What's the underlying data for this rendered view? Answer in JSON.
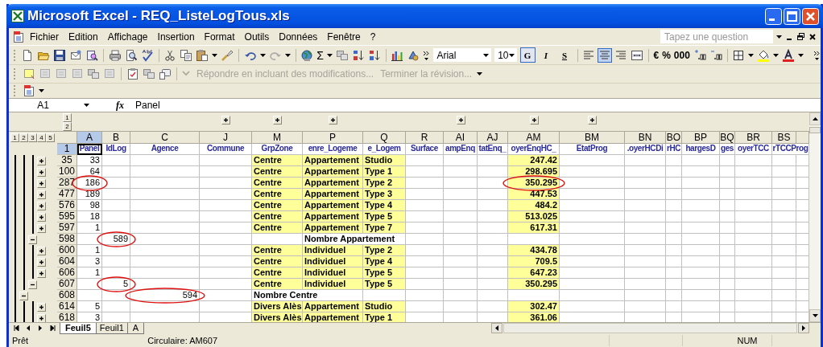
{
  "window": {
    "title": "Microsoft Excel - REQ_ListeLogTous.xls"
  },
  "menu": {
    "items": [
      "Fichier",
      "Edition",
      "Affichage",
      "Insertion",
      "Format",
      "Outils",
      "Données",
      "Fenêtre",
      "?"
    ],
    "question_field": {
      "placeholder": "Tapez une question"
    }
  },
  "toolbar": {
    "sum_symbol": "Σ",
    "font": "Arial",
    "font_size": "10",
    "style_buttons": [
      {
        "label": "G",
        "pressed": true
      },
      {
        "label": "I",
        "pressed": false
      },
      {
        "label": "S",
        "pressed": false
      }
    ],
    "alignment": [
      {
        "kind": "left",
        "pressed": false
      },
      {
        "kind": "center",
        "pressed": true
      },
      {
        "kind": "right",
        "pressed": false
      }
    ],
    "number_formats": [
      "€",
      "%",
      "000"
    ]
  },
  "review_toolbar": {
    "items": [
      {
        "label": "Répondre en incluant des modifications...",
        "disabled": true
      },
      {
        "label": "Terminer la révision...",
        "disabled": true
      }
    ]
  },
  "formula_bar": {
    "cell": "A1",
    "fx": "fx",
    "formula": "Panel"
  },
  "sheet": {
    "row_outline_levels": [
      "1",
      "2",
      "3",
      "4",
      "5"
    ],
    "column_outline_levels": [
      "1",
      "2"
    ],
    "columns": [
      {
        "letter": "A",
        "header": "Panel",
        "selected": true,
        "group_button": false
      },
      {
        "letter": "B",
        "header": "IdLog",
        "selected": false,
        "group_button": false
      },
      {
        "letter": "C",
        "header": "Agence",
        "selected": false,
        "group_button": false
      },
      {
        "letter": "J",
        "header": "Commune",
        "selected": false,
        "group_button": true
      },
      {
        "letter": "M",
        "header": "GrpZone",
        "selected": false,
        "group_button": true
      },
      {
        "letter": "P",
        "header": "enre_Logeme",
        "selected": false,
        "group_button": true
      },
      {
        "letter": "Q",
        "header": "e_Logem",
        "selected": false,
        "group_button": false
      },
      {
        "letter": "R",
        "header": "Surface",
        "selected": false,
        "group_button": false
      },
      {
        "letter": "AI",
        "header": "ampEnq",
        "selected": false,
        "group_button": true
      },
      {
        "letter": "AJ",
        "header": "tatEnq_",
        "selected": false,
        "group_button": false
      },
      {
        "letter": "AM",
        "header": "oyerEnqHC_",
        "selected": false,
        "group_button": true
      },
      {
        "letter": "BM",
        "header": "EtatProg",
        "selected": false,
        "group_button": true
      },
      {
        "letter": "BN",
        "header": ".oyerHCDi",
        "selected": false,
        "group_button": false
      },
      {
        "letter": "BO",
        "header": "rHC",
        "selected": false,
        "group_button": false
      },
      {
        "letter": "BP",
        "header": "hargesD",
        "selected": false,
        "group_button": false
      },
      {
        "letter": "BQ",
        "header": "ges",
        "selected": false,
        "group_button": false
      },
      {
        "letter": "BR",
        "header": "oyerTCC",
        "selected": false,
        "group_button": false
      },
      {
        "letter": "BS",
        "header": "rTCCProg",
        "selected": false,
        "group_button": false
      }
    ],
    "header_row": {
      "number": "1",
      "selected": true
    },
    "rows": [
      {
        "number": "35",
        "kind": "detail",
        "cells": [
          {
            "text": "33",
            "highlighted": false,
            "circled": false
          },
          {
            "text": "",
            "highlighted": false,
            "circled": false
          },
          {
            "text": "",
            "highlighted": false,
            "circled": false
          },
          {
            "text": "",
            "highlighted": false,
            "circled": false
          },
          {
            "text": "Centre",
            "highlighted": true,
            "circled": false
          },
          {
            "text": "Appartement",
            "highlighted": true,
            "circled": false
          },
          {
            "text": "Studio",
            "highlighted": true,
            "circled": false
          },
          {
            "text": "",
            "highlighted": false,
            "circled": false
          },
          {
            "text": "",
            "highlighted": false,
            "circled": false
          },
          {
            "text": "",
            "highlighted": false,
            "circled": false
          },
          {
            "text": "247.42",
            "highlighted": true,
            "circled": false
          },
          {
            "text": "",
            "highlighted": false,
            "circled": false
          },
          {
            "text": "",
            "highlighted": false,
            "circled": false
          },
          {
            "text": "",
            "highlighted": false,
            "circled": false
          },
          {
            "text": "",
            "highlighted": false,
            "circled": false
          },
          {
            "text": "",
            "highlighted": false,
            "circled": false
          },
          {
            "text": "",
            "highlighted": false,
            "circled": false
          },
          {
            "text": "",
            "highlighted": false,
            "circled": false
          }
        ]
      },
      {
        "number": "100",
        "kind": "detail",
        "cells": [
          {
            "text": "64",
            "highlighted": false,
            "circled": false
          },
          {
            "text": "",
            "highlighted": false,
            "circled": false
          },
          {
            "text": "",
            "highlighted": false,
            "circled": false
          },
          {
            "text": "",
            "highlighted": false,
            "circled": false
          },
          {
            "text": "Centre",
            "highlighted": true,
            "circled": false
          },
          {
            "text": "Appartement",
            "highlighted": true,
            "circled": false
          },
          {
            "text": "Type 1",
            "highlighted": true,
            "circled": false
          },
          {
            "text": "",
            "highlighted": false,
            "circled": false
          },
          {
            "text": "",
            "highlighted": false,
            "circled": false
          },
          {
            "text": "",
            "highlighted": false,
            "circled": false
          },
          {
            "text": "298.695",
            "highlighted": true,
            "circled": false
          },
          {
            "text": "",
            "highlighted": false,
            "circled": false
          },
          {
            "text": "",
            "highlighted": false,
            "circled": false
          },
          {
            "text": "",
            "highlighted": false,
            "circled": false
          },
          {
            "text": "",
            "highlighted": false,
            "circled": false
          },
          {
            "text": "",
            "highlighted": false,
            "circled": false
          },
          {
            "text": "",
            "highlighted": false,
            "circled": false
          },
          {
            "text": "",
            "highlighted": false,
            "circled": false
          }
        ]
      },
      {
        "number": "287",
        "kind": "detail",
        "cells": [
          {
            "text": "186",
            "highlighted": false,
            "circled": true
          },
          {
            "text": "",
            "highlighted": false,
            "circled": false
          },
          {
            "text": "",
            "highlighted": false,
            "circled": false
          },
          {
            "text": "",
            "highlighted": false,
            "circled": false
          },
          {
            "text": "Centre",
            "highlighted": true,
            "circled": false
          },
          {
            "text": "Appartement",
            "highlighted": true,
            "circled": false
          },
          {
            "text": "Type 2",
            "highlighted": true,
            "circled": false
          },
          {
            "text": "",
            "highlighted": false,
            "circled": false
          },
          {
            "text": "",
            "highlighted": false,
            "circled": false
          },
          {
            "text": "",
            "highlighted": false,
            "circled": false
          },
          {
            "text": "350.295",
            "highlighted": true,
            "circled": true
          },
          {
            "text": "",
            "highlighted": false,
            "circled": false
          },
          {
            "text": "",
            "highlighted": false,
            "circled": false
          },
          {
            "text": "",
            "highlighted": false,
            "circled": false
          },
          {
            "text": "",
            "highlighted": false,
            "circled": false
          },
          {
            "text": "",
            "highlighted": false,
            "circled": false
          },
          {
            "text": "",
            "highlighted": false,
            "circled": false
          },
          {
            "text": "",
            "highlighted": false,
            "circled": false
          }
        ]
      },
      {
        "number": "477",
        "kind": "detail",
        "cells": [
          {
            "text": "189",
            "highlighted": false,
            "circled": false
          },
          {
            "text": "",
            "highlighted": false,
            "circled": false
          },
          {
            "text": "",
            "highlighted": false,
            "circled": false
          },
          {
            "text": "",
            "highlighted": false,
            "circled": false
          },
          {
            "text": "Centre",
            "highlighted": true,
            "circled": false
          },
          {
            "text": "Appartement",
            "highlighted": true,
            "circled": false
          },
          {
            "text": "Type 3",
            "highlighted": true,
            "circled": false
          },
          {
            "text": "",
            "highlighted": false,
            "circled": false
          },
          {
            "text": "",
            "highlighted": false,
            "circled": false
          },
          {
            "text": "",
            "highlighted": false,
            "circled": false
          },
          {
            "text": "447.53",
            "highlighted": true,
            "circled": false
          },
          {
            "text": "",
            "highlighted": false,
            "circled": false
          },
          {
            "text": "",
            "highlighted": false,
            "circled": false
          },
          {
            "text": "",
            "highlighted": false,
            "circled": false
          },
          {
            "text": "",
            "highlighted": false,
            "circled": false
          },
          {
            "text": "",
            "highlighted": false,
            "circled": false
          },
          {
            "text": "",
            "highlighted": false,
            "circled": false
          },
          {
            "text": "",
            "highlighted": false,
            "circled": false
          }
        ]
      },
      {
        "number": "576",
        "kind": "detail",
        "cells": [
          {
            "text": "98",
            "highlighted": false,
            "circled": false
          },
          {
            "text": "",
            "highlighted": false,
            "circled": false
          },
          {
            "text": "",
            "highlighted": false,
            "circled": false
          },
          {
            "text": "",
            "highlighted": false,
            "circled": false
          },
          {
            "text": "Centre",
            "highlighted": true,
            "circled": false
          },
          {
            "text": "Appartement",
            "highlighted": true,
            "circled": false
          },
          {
            "text": "Type 4",
            "highlighted": true,
            "circled": false
          },
          {
            "text": "",
            "highlighted": false,
            "circled": false
          },
          {
            "text": "",
            "highlighted": false,
            "circled": false
          },
          {
            "text": "",
            "highlighted": false,
            "circled": false
          },
          {
            "text": "484.2",
            "highlighted": true,
            "circled": false
          },
          {
            "text": "",
            "highlighted": false,
            "circled": false
          },
          {
            "text": "",
            "highlighted": false,
            "circled": false
          },
          {
            "text": "",
            "highlighted": false,
            "circled": false
          },
          {
            "text": "",
            "highlighted": false,
            "circled": false
          },
          {
            "text": "",
            "highlighted": false,
            "circled": false
          },
          {
            "text": "",
            "highlighted": false,
            "circled": false
          },
          {
            "text": "",
            "highlighted": false,
            "circled": false
          }
        ]
      },
      {
        "number": "595",
        "kind": "detail",
        "cells": [
          {
            "text": "18",
            "highlighted": false,
            "circled": false
          },
          {
            "text": "",
            "highlighted": false,
            "circled": false
          },
          {
            "text": "",
            "highlighted": false,
            "circled": false
          },
          {
            "text": "",
            "highlighted": false,
            "circled": false
          },
          {
            "text": "Centre",
            "highlighted": true,
            "circled": false
          },
          {
            "text": "Appartement",
            "highlighted": true,
            "circled": false
          },
          {
            "text": "Type 5",
            "highlighted": true,
            "circled": false
          },
          {
            "text": "",
            "highlighted": false,
            "circled": false
          },
          {
            "text": "",
            "highlighted": false,
            "circled": false
          },
          {
            "text": "",
            "highlighted": false,
            "circled": false
          },
          {
            "text": "513.025",
            "highlighted": true,
            "circled": false
          },
          {
            "text": "",
            "highlighted": false,
            "circled": false
          },
          {
            "text": "",
            "highlighted": false,
            "circled": false
          },
          {
            "text": "",
            "highlighted": false,
            "circled": false
          },
          {
            "text": "",
            "highlighted": false,
            "circled": false
          },
          {
            "text": "",
            "highlighted": false,
            "circled": false
          },
          {
            "text": "",
            "highlighted": false,
            "circled": false
          },
          {
            "text": "",
            "highlighted": false,
            "circled": false
          }
        ]
      },
      {
        "number": "597",
        "kind": "detail",
        "cells": [
          {
            "text": "1",
            "highlighted": false,
            "circled": false
          },
          {
            "text": "",
            "highlighted": false,
            "circled": false
          },
          {
            "text": "",
            "highlighted": false,
            "circled": false
          },
          {
            "text": "",
            "highlighted": false,
            "circled": false
          },
          {
            "text": "Centre",
            "highlighted": true,
            "circled": false
          },
          {
            "text": "Appartement",
            "highlighted": true,
            "circled": false
          },
          {
            "text": "Type 7",
            "highlighted": true,
            "circled": false
          },
          {
            "text": "",
            "highlighted": false,
            "circled": false
          },
          {
            "text": "",
            "highlighted": false,
            "circled": false
          },
          {
            "text": "",
            "highlighted": false,
            "circled": false
          },
          {
            "text": "617.31",
            "highlighted": true,
            "circled": false
          },
          {
            "text": "",
            "highlighted": false,
            "circled": false
          },
          {
            "text": "",
            "highlighted": false,
            "circled": false
          },
          {
            "text": "",
            "highlighted": false,
            "circled": false
          },
          {
            "text": "",
            "highlighted": false,
            "circled": false
          },
          {
            "text": "",
            "highlighted": false,
            "circled": false
          },
          {
            "text": "",
            "highlighted": false,
            "circled": false
          },
          {
            "text": "",
            "highlighted": false,
            "circled": false
          }
        ]
      },
      {
        "number": "598",
        "kind": "subtotal",
        "cells": [
          {
            "text": "",
            "highlighted": false,
            "circled": false
          },
          {
            "text": "589",
            "highlighted": false,
            "circled": true
          },
          {
            "text": "",
            "highlighted": false,
            "circled": false
          },
          {
            "text": "",
            "highlighted": false,
            "circled": false
          },
          {
            "text": "",
            "highlighted": false,
            "circled": false
          },
          {
            "text": "Nombre Appartement",
            "highlighted": false,
            "circled": false
          },
          {
            "text": "",
            "highlighted": false,
            "circled": false
          },
          {
            "text": "",
            "highlighted": false,
            "circled": false
          },
          {
            "text": "",
            "highlighted": false,
            "circled": false
          },
          {
            "text": "",
            "highlighted": false,
            "circled": false
          },
          {
            "text": "",
            "highlighted": false,
            "circled": false
          },
          {
            "text": "",
            "highlighted": false,
            "circled": false
          },
          {
            "text": "",
            "highlighted": false,
            "circled": false
          },
          {
            "text": "",
            "highlighted": false,
            "circled": false
          },
          {
            "text": "",
            "highlighted": false,
            "circled": false
          },
          {
            "text": "",
            "highlighted": false,
            "circled": false
          },
          {
            "text": "",
            "highlighted": false,
            "circled": false
          },
          {
            "text": "",
            "highlighted": false,
            "circled": false
          }
        ]
      },
      {
        "number": "600",
        "kind": "detail",
        "cells": [
          {
            "text": "1",
            "highlighted": false,
            "circled": false
          },
          {
            "text": "",
            "highlighted": false,
            "circled": false
          },
          {
            "text": "",
            "highlighted": false,
            "circled": false
          },
          {
            "text": "",
            "highlighted": false,
            "circled": false
          },
          {
            "text": "Centre",
            "highlighted": true,
            "circled": false
          },
          {
            "text": "Individuel",
            "highlighted": true,
            "circled": false
          },
          {
            "text": "Type 2",
            "highlighted": true,
            "circled": false
          },
          {
            "text": "",
            "highlighted": false,
            "circled": false
          },
          {
            "text": "",
            "highlighted": false,
            "circled": false
          },
          {
            "text": "",
            "highlighted": false,
            "circled": false
          },
          {
            "text": "434.78",
            "highlighted": true,
            "circled": false
          },
          {
            "text": "",
            "highlighted": false,
            "circled": false
          },
          {
            "text": "",
            "highlighted": false,
            "circled": false
          },
          {
            "text": "",
            "highlighted": false,
            "circled": false
          },
          {
            "text": "",
            "highlighted": false,
            "circled": false
          },
          {
            "text": "",
            "highlighted": false,
            "circled": false
          },
          {
            "text": "",
            "highlighted": false,
            "circled": false
          },
          {
            "text": "",
            "highlighted": false,
            "circled": false
          }
        ]
      },
      {
        "number": "604",
        "kind": "detail",
        "cells": [
          {
            "text": "3",
            "highlighted": false,
            "circled": false
          },
          {
            "text": "",
            "highlighted": false,
            "circled": false
          },
          {
            "text": "",
            "highlighted": false,
            "circled": false
          },
          {
            "text": "",
            "highlighted": false,
            "circled": false
          },
          {
            "text": "Centre",
            "highlighted": true,
            "circled": false
          },
          {
            "text": "Individuel",
            "highlighted": true,
            "circled": false
          },
          {
            "text": "Type 4",
            "highlighted": true,
            "circled": false
          },
          {
            "text": "",
            "highlighted": false,
            "circled": false
          },
          {
            "text": "",
            "highlighted": false,
            "circled": false
          },
          {
            "text": "",
            "highlighted": false,
            "circled": false
          },
          {
            "text": "709.5",
            "highlighted": true,
            "circled": false
          },
          {
            "text": "",
            "highlighted": false,
            "circled": false
          },
          {
            "text": "",
            "highlighted": false,
            "circled": false
          },
          {
            "text": "",
            "highlighted": false,
            "circled": false
          },
          {
            "text": "",
            "highlighted": false,
            "circled": false
          },
          {
            "text": "",
            "highlighted": false,
            "circled": false
          },
          {
            "text": "",
            "highlighted": false,
            "circled": false
          },
          {
            "text": "",
            "highlighted": false,
            "circled": false
          }
        ]
      },
      {
        "number": "606",
        "kind": "detail",
        "cells": [
          {
            "text": "1",
            "highlighted": false,
            "circled": false
          },
          {
            "text": "",
            "highlighted": false,
            "circled": false
          },
          {
            "text": "",
            "highlighted": false,
            "circled": false
          },
          {
            "text": "",
            "highlighted": false,
            "circled": false
          },
          {
            "text": "Centre",
            "highlighted": true,
            "circled": false
          },
          {
            "text": "Individuel",
            "highlighted": true,
            "circled": false
          },
          {
            "text": "Type 5",
            "highlighted": true,
            "circled": false
          },
          {
            "text": "",
            "highlighted": false,
            "circled": false
          },
          {
            "text": "",
            "highlighted": false,
            "circled": false
          },
          {
            "text": "",
            "highlighted": false,
            "circled": false
          },
          {
            "text": "647.23",
            "highlighted": true,
            "circled": false
          },
          {
            "text": "",
            "highlighted": false,
            "circled": false
          },
          {
            "text": "",
            "highlighted": false,
            "circled": false
          },
          {
            "text": "",
            "highlighted": false,
            "circled": false
          },
          {
            "text": "",
            "highlighted": false,
            "circled": false
          },
          {
            "text": "",
            "highlighted": false,
            "circled": false
          },
          {
            "text": "",
            "highlighted": false,
            "circled": false
          },
          {
            "text": "",
            "highlighted": false,
            "circled": false
          }
        ]
      },
      {
        "number": "607",
        "kind": "subtotal",
        "cells": [
          {
            "text": "",
            "highlighted": false,
            "circled": false
          },
          {
            "text": "5",
            "highlighted": false,
            "circled": true
          },
          {
            "text": "",
            "highlighted": false,
            "circled": false
          },
          {
            "text": "",
            "highlighted": false,
            "circled": false
          },
          {
            "text": "Centre",
            "highlighted": true,
            "circled": false
          },
          {
            "text": "Individuel",
            "highlighted": true,
            "circled": false
          },
          {
            "text": "Type 5",
            "highlighted": true,
            "circled": false
          },
          {
            "text": "",
            "highlighted": false,
            "circled": false
          },
          {
            "text": "",
            "highlighted": false,
            "circled": false
          },
          {
            "text": "",
            "highlighted": false,
            "circled": false
          },
          {
            "text": "350.295",
            "highlighted": true,
            "circled": false
          },
          {
            "text": "",
            "highlighted": false,
            "circled": false
          },
          {
            "text": "",
            "highlighted": false,
            "circled": false
          },
          {
            "text": "",
            "highlighted": false,
            "circled": false
          },
          {
            "text": "",
            "highlighted": false,
            "circled": false
          },
          {
            "text": "",
            "highlighted": false,
            "circled": false
          },
          {
            "text": "",
            "highlighted": false,
            "circled": false
          },
          {
            "text": "",
            "highlighted": false,
            "circled": false
          }
        ]
      },
      {
        "number": "608",
        "kind": "total",
        "cells": [
          {
            "text": "",
            "highlighted": false,
            "circled": false
          },
          {
            "text": "",
            "highlighted": false,
            "circled": false
          },
          {
            "text": "594",
            "highlighted": false,
            "circled": true
          },
          {
            "text": "",
            "highlighted": false,
            "circled": false
          },
          {
            "text": "Nombre Centre",
            "highlighted": false,
            "circled": false
          },
          {
            "text": "",
            "highlighted": false,
            "circled": false
          },
          {
            "text": "",
            "highlighted": false,
            "circled": false
          },
          {
            "text": "",
            "highlighted": false,
            "circled": false
          },
          {
            "text": "",
            "highlighted": false,
            "circled": false
          },
          {
            "text": "",
            "highlighted": false,
            "circled": false
          },
          {
            "text": "",
            "highlighted": false,
            "circled": false
          },
          {
            "text": "",
            "highlighted": false,
            "circled": false
          },
          {
            "text": "",
            "highlighted": false,
            "circled": false
          },
          {
            "text": "",
            "highlighted": false,
            "circled": false
          },
          {
            "text": "",
            "highlighted": false,
            "circled": false
          },
          {
            "text": "",
            "highlighted": false,
            "circled": false
          },
          {
            "text": "",
            "highlighted": false,
            "circled": false
          },
          {
            "text": "",
            "highlighted": false,
            "circled": false
          }
        ]
      },
      {
        "number": "614",
        "kind": "detail",
        "cells": [
          {
            "text": "5",
            "highlighted": false,
            "circled": false
          },
          {
            "text": "",
            "highlighted": false,
            "circled": false
          },
          {
            "text": "",
            "highlighted": false,
            "circled": false
          },
          {
            "text": "",
            "highlighted": false,
            "circled": false
          },
          {
            "text": "Divers Alès",
            "highlighted": true,
            "circled": false
          },
          {
            "text": "Appartement",
            "highlighted": true,
            "circled": false
          },
          {
            "text": "Studio",
            "highlighted": true,
            "circled": false
          },
          {
            "text": "",
            "highlighted": false,
            "circled": false
          },
          {
            "text": "",
            "highlighted": false,
            "circled": false
          },
          {
            "text": "",
            "highlighted": false,
            "circled": false
          },
          {
            "text": "302.47",
            "highlighted": true,
            "circled": false
          },
          {
            "text": "",
            "highlighted": false,
            "circled": false
          },
          {
            "text": "",
            "highlighted": false,
            "circled": false
          },
          {
            "text": "",
            "highlighted": false,
            "circled": false
          },
          {
            "text": "",
            "highlighted": false,
            "circled": false
          },
          {
            "text": "",
            "highlighted": false,
            "circled": false
          },
          {
            "text": "",
            "highlighted": false,
            "circled": false
          },
          {
            "text": "",
            "highlighted": false,
            "circled": false
          }
        ]
      },
      {
        "number": "618",
        "kind": "detail",
        "cells": [
          {
            "text": "3",
            "highlighted": false,
            "circled": false
          },
          {
            "text": "",
            "highlighted": false,
            "circled": false
          },
          {
            "text": "",
            "highlighted": false,
            "circled": false
          },
          {
            "text": "",
            "highlighted": false,
            "circled": false
          },
          {
            "text": "Divers Alès",
            "highlighted": true,
            "circled": false
          },
          {
            "text": "Appartement",
            "highlighted": true,
            "circled": false
          },
          {
            "text": "Type 1",
            "highlighted": true,
            "circled": false
          },
          {
            "text": "",
            "highlighted": false,
            "circled": false
          },
          {
            "text": "",
            "highlighted": false,
            "circled": false
          },
          {
            "text": "",
            "highlighted": false,
            "circled": false
          },
          {
            "text": "361.06",
            "highlighted": true,
            "circled": false
          },
          {
            "text": "",
            "highlighted": false,
            "circled": false
          },
          {
            "text": "",
            "highlighted": false,
            "circled": false
          },
          {
            "text": "",
            "highlighted": false,
            "circled": false
          },
          {
            "text": "",
            "highlighted": false,
            "circled": false
          },
          {
            "text": "",
            "highlighted": false,
            "circled": false
          },
          {
            "text": "",
            "highlighted": false,
            "circled": false
          },
          {
            "text": "",
            "highlighted": false,
            "circled": false
          }
        ]
      }
    ]
  },
  "sheet_tabs": [
    {
      "label": "Feuil5",
      "selected": true
    },
    {
      "label": "Feuil1",
      "selected": false
    },
    {
      "label": "A",
      "selected": false
    }
  ],
  "status_bar": {
    "status": "Prêt",
    "message": "Circulaire: AM607",
    "indicator": "NUM"
  }
}
